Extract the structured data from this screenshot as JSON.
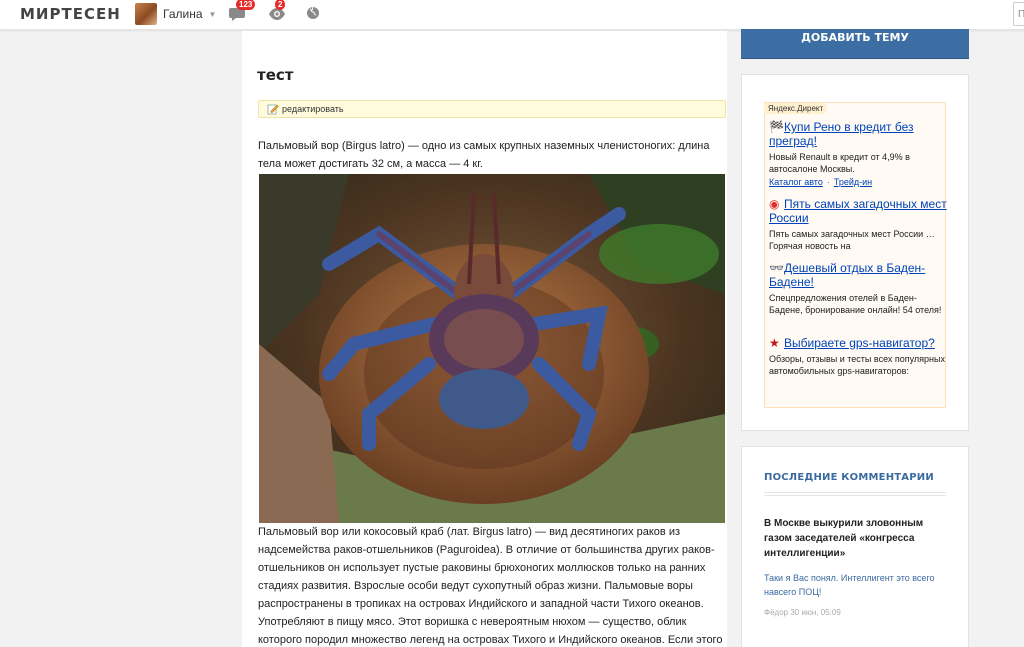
{
  "site": {
    "logo": "МИРТЕСЕН"
  },
  "user": {
    "name": "Галина"
  },
  "notifications": {
    "messages_count": "123",
    "views_count": "2",
    "icons": [
      "chat-icon",
      "eye-icon",
      "globe-icon"
    ]
  },
  "search": {
    "stub": "П"
  },
  "post": {
    "title": "тест",
    "edit_label": "редактировать",
    "paragraph1": "Пальмовый вор (Birgus latro) — одно из самых крупных наземных членистоногих: длина тела может достигать 32 см, а масса — 4 кг.",
    "paragraph2": "Пальмовый вор или кокосовый краб (лат. Birgus latro) — вид десятиногих раков из надсемейства раков-отшельников (Paguroidea). В отличие от большинства других раков-отшельников он использует пустые раковины брюхоногих моллюсков только на ранних стадиях развития. Взрослые особи ведут сухопутный образ жизни. Пальмовые воры распространены в тропиках на островах Индийского и западной части Тихого океанов. Употребляют в пищу мясо. Этот воришка с невероятным нюхом — существо, облик которого породил множество легенд на островах Тихого и Индийского океанов. Если этого"
  },
  "sidebar": {
    "add_topic": "ДОБАВИТЬ ТЕМУ",
    "yandex_tag": "Яндекс.Директ",
    "ads": [
      {
        "title": "Купи Рено в кредит без преград!",
        "text": "Новый Renault в кредит от 4,9% в автосалоне Москвы.",
        "links": [
          "Каталог авто",
          "Трейд-ин"
        ],
        "link_separator": "·",
        "icon": "car-icon"
      },
      {
        "title": "Пять самых загадочных мест России",
        "text": "Пять самых загадочных мест России … Горячая новость на",
        "icon": "target-icon"
      },
      {
        "title": "Дешевый отдых в Баден-Бадене!",
        "text": "Спецпредложения отелей в Баден-Бадене, бронирование онлайн! 54 отеля!",
        "icon": "glasses-icon"
      },
      {
        "title": "Выбираете gps-навигатор?",
        "text": "Обзоры, отзывы и тесты всех популярных автомобильных gps-навигаторов:",
        "icon": "star-icon"
      }
    ],
    "comments": {
      "heading": "ПОСЛЕДНИЕ КОММЕНТАРИИ",
      "item": {
        "title": "В Москве выкурили зловонным газом заседателей «конгресса интеллигенции»",
        "text": "Таки я Вас понял. Интеллигент это всего навсего ПОЦ!",
        "meta": "Фёдор 30 июн, 05:09"
      }
    }
  },
  "colors": {
    "accent": "#3d6ea3",
    "link": "#0044bb",
    "badge": "#e52b2b",
    "edit_bg": "#fffbdc"
  }
}
